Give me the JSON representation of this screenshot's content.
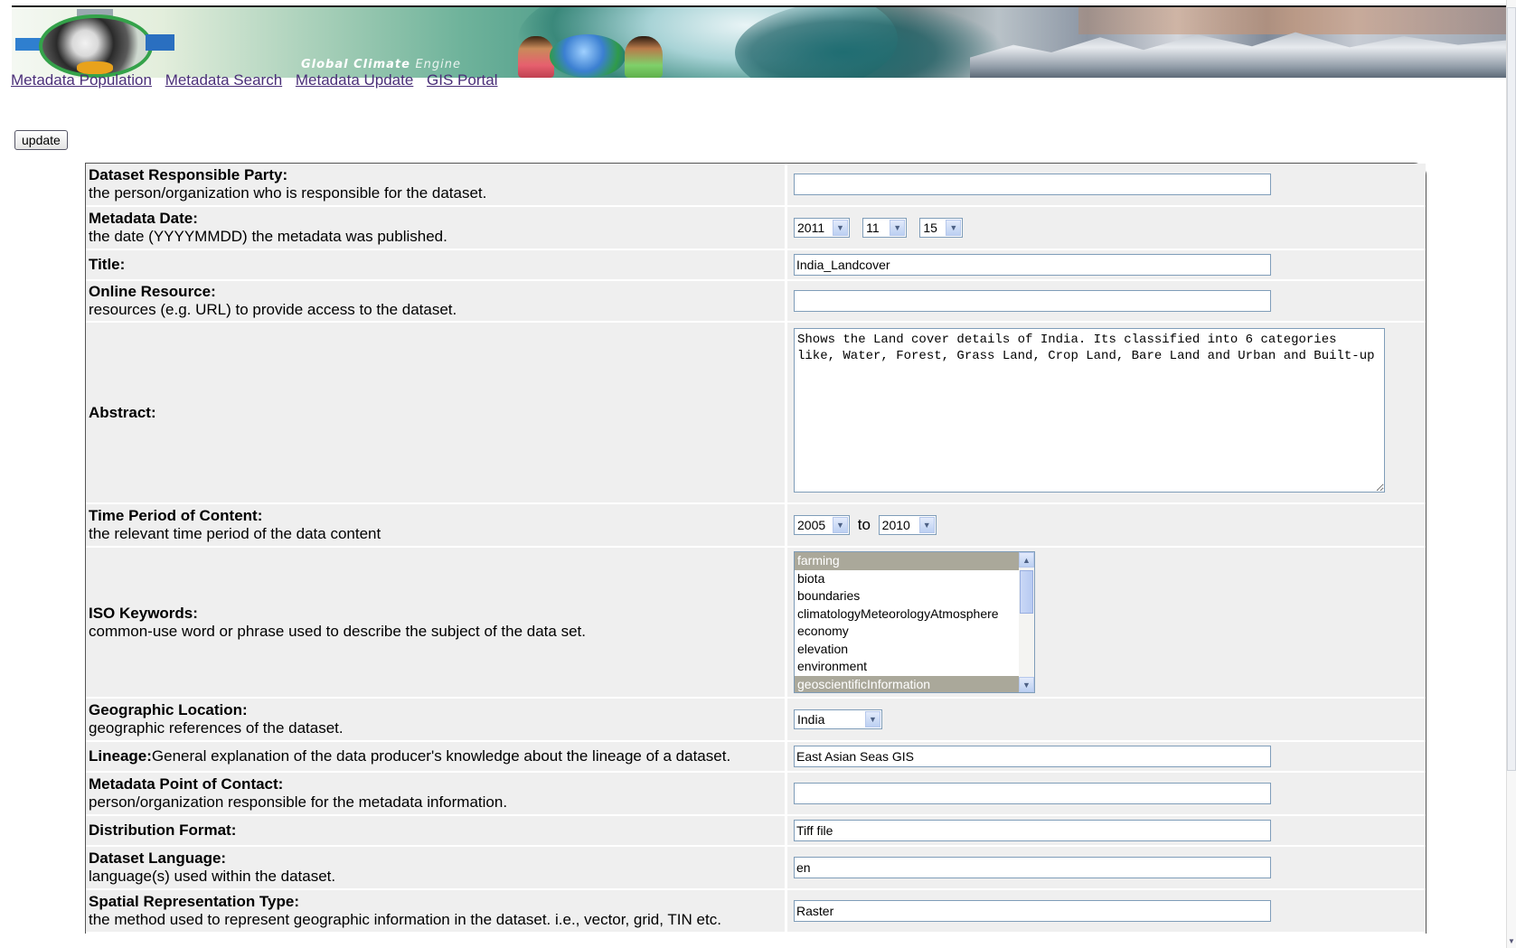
{
  "banner": {
    "title": "Global Climate",
    "title_suffix": "Engine"
  },
  "nav": {
    "links": [
      "Metadata Population",
      "Metadata Search",
      "Metadata Update",
      "GIS Portal"
    ]
  },
  "toolbar": {
    "update_label": "update"
  },
  "fields": {
    "responsible_party": {
      "label": "Dataset Responsible Party:",
      "desc": "the person/organization who is responsible for the dataset.",
      "value": ""
    },
    "metadata_date": {
      "label": "Metadata Date:",
      "desc": "the date (YYYYMMDD) the metadata was published.",
      "year": "2011",
      "month": "11",
      "day": "15"
    },
    "title": {
      "label": "Title:",
      "value": "India_Landcover"
    },
    "online_resource": {
      "label": "Online Resource:",
      "desc": "resources (e.g. URL) to provide access to the dataset.",
      "value": ""
    },
    "abstract": {
      "label": "Abstract:",
      "value": "Shows the Land cover details of India. Its classified into 6 categories like, Water, Forest, Grass Land, Crop Land, Bare Land and Urban and Built-up"
    },
    "time_period": {
      "label": "Time Period of Content:",
      "desc": "the relevant time period of the data content",
      "from": "2005",
      "to_label": "to",
      "to": "2010"
    },
    "iso_keywords": {
      "label": "ISO Keywords:",
      "desc": "common-use word or phrase used to describe the subject of the data set.",
      "options": [
        "farming",
        "biota",
        "boundaries",
        "climatologyMeteorologyAtmosphere",
        "economy",
        "elevation",
        "environment",
        "geoscientificInformation"
      ],
      "selected": [
        "farming",
        "geoscientificInformation"
      ]
    },
    "geo_location": {
      "label": "Geographic Location:",
      "desc": "geographic references of the dataset.",
      "value": "India"
    },
    "lineage": {
      "label": "Lineage:",
      "desc": "General explanation of the data producer's knowledge about the lineage of a dataset.",
      "value": "East Asian Seas GIS"
    },
    "point_of_contact": {
      "label": "Metadata Point of Contact:",
      "desc": "person/organization responsible for the metadata information.",
      "value": ""
    },
    "distribution_format": {
      "label": "Distribution Format:",
      "value": "Tiff file"
    },
    "dataset_language": {
      "label": "Dataset Language:",
      "desc": "language(s) used within the dataset.",
      "value": "en"
    },
    "spatial_rep_type": {
      "label": "Spatial Representation Type:",
      "desc": "the method used to represent geographic information in the dataset. i.e., vector, grid, TIN etc.",
      "value": "Raster"
    }
  },
  "colors": {
    "row_bg": "#efefef",
    "link": "#4a2f78",
    "input_border": "#7f9db9",
    "list_selected": "#aaa89a"
  },
  "icons": {
    "dropdown": "chevron-down-icon",
    "scroll_up": "chevron-up-icon",
    "scroll_down": "chevron-down-icon"
  }
}
